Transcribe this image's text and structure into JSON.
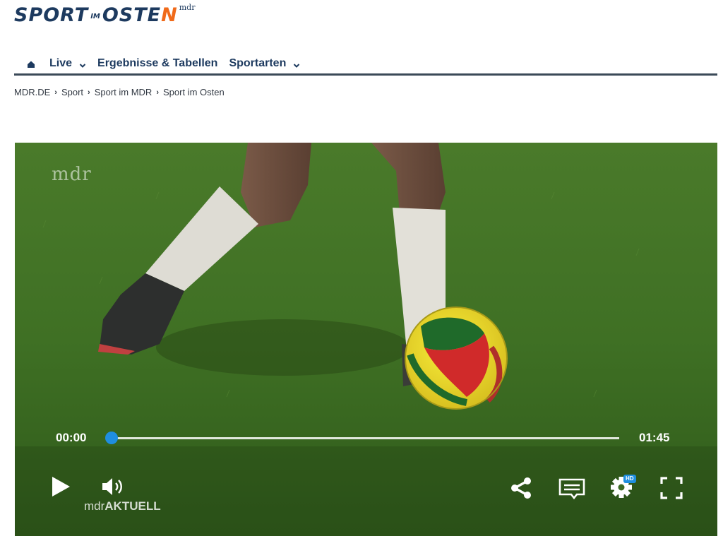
{
  "logo": {
    "sport": "SPORT",
    "im": "IM",
    "osten_main": "OSTE",
    "osten_accent": "N",
    "mdr": "mdr"
  },
  "nav": {
    "items": [
      {
        "label": "Live",
        "has_dropdown": true
      },
      {
        "label": "Ergebnisse & Tabellen",
        "has_dropdown": false
      },
      {
        "label": "Sportarten",
        "has_dropdown": true
      }
    ]
  },
  "breadcrumb": [
    "MDR.DE",
    "Sport",
    "Sport im MDR",
    "Sport im Osten"
  ],
  "player": {
    "watermark": "mdr",
    "current_time": "00:00",
    "total_time": "01:45",
    "progress": 0,
    "settings_badge": "HD",
    "station_prefix": "mdr",
    "station_name": "AKTUELL",
    "accent_color": "#1f8ee0"
  },
  "colors": {
    "brand": "#1d3a5f",
    "logo_accent": "#f06a1a"
  }
}
